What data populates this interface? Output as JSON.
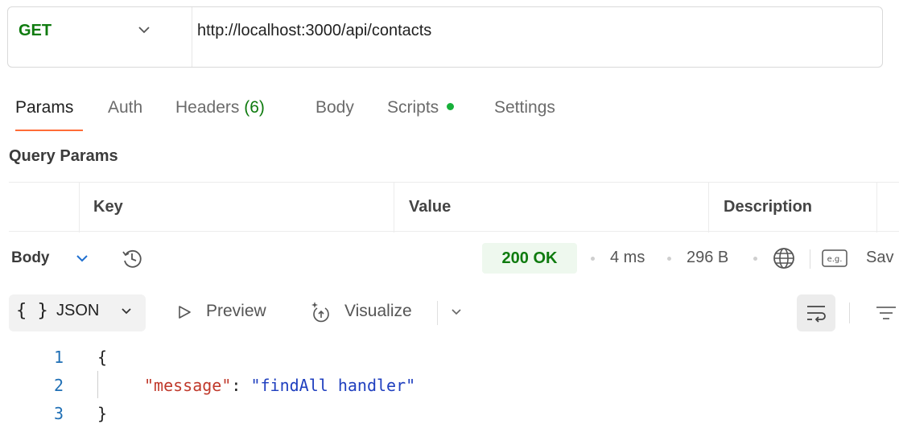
{
  "request": {
    "method": "GET",
    "url": "http://localhost:3000/api/contacts"
  },
  "tabs": {
    "params": "Params",
    "auth": "Auth",
    "headers": "Headers",
    "headers_count": "(6)",
    "body": "Body",
    "scripts": "Scripts",
    "settings": "Settings",
    "active": "Params"
  },
  "query_params": {
    "title": "Query Params",
    "columns": [
      "Key",
      "Value",
      "Description"
    ]
  },
  "response": {
    "section_label": "Body",
    "status": "200 OK",
    "time": "4 ms",
    "size": "296 B",
    "save_label": "Sav",
    "format": {
      "braces": "{ }",
      "json_label": "JSON",
      "preview_label": "Preview",
      "visualize_label": "Visualize"
    },
    "code_lines": [
      {
        "num": "1",
        "text": "{"
      },
      {
        "num": "2",
        "key": "\"message\"",
        "colon": ": ",
        "value": "\"findAll handler\""
      },
      {
        "num": "3",
        "text": "}"
      }
    ]
  },
  "colors": {
    "method_get": "#0f7b0f",
    "active_tab_underline": "#ff6c37",
    "scripts_dot": "#17b03a",
    "status_ok_bg": "#eef8ee",
    "json_key": "#c0392b",
    "json_string": "#1f3fbf",
    "line_number": "#1f6fb5"
  },
  "icons": {
    "method_dropdown": "chevron-down-icon",
    "history": "history-icon",
    "network": "globe-icon",
    "example": "example-icon",
    "preview": "play-icon",
    "visualize": "visualize-icon",
    "wrap": "wrap-lines-icon",
    "filter": "filter-icon"
  }
}
